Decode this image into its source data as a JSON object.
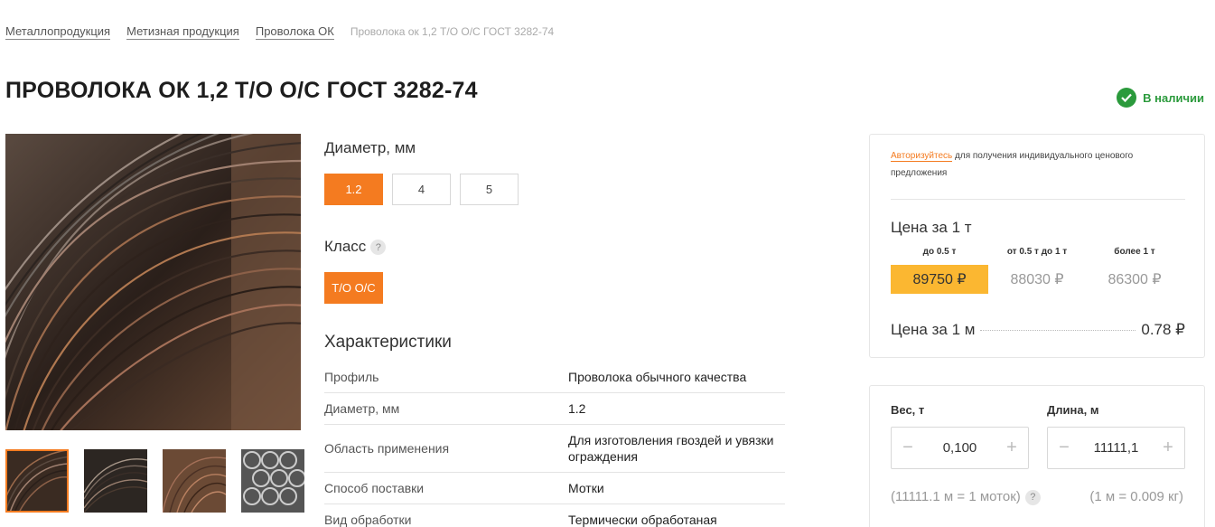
{
  "breadcrumb": {
    "items": [
      "Металлопродукция",
      "Метизная продукция",
      "Проволока ОК"
    ],
    "current": "Проволока ок 1,2 Т/О О/С ГОСТ 3282-74"
  },
  "title": "ПРОВОЛОКА ОК 1,2 Т/О О/С ГОСТ 3282-74",
  "stock": {
    "label": "В наличии",
    "color": "#2b9a3c"
  },
  "diameter": {
    "label": "Диаметр, мм",
    "options": [
      "1.2",
      "4",
      "5"
    ],
    "selected": "1.2"
  },
  "class": {
    "label": "Класс",
    "help": "?",
    "options": [
      "Т/О О/С"
    ],
    "selected": "Т/О О/С"
  },
  "characteristics": {
    "title": "Характеристики",
    "rows": [
      {
        "key": "Профиль",
        "value": "Проволока обычного качества"
      },
      {
        "key": "Диаметр, мм",
        "value": "1.2"
      },
      {
        "key": "Область применения",
        "value": "Для изготовления гвоздей и увязки ограждения"
      },
      {
        "key": "Способ поставки",
        "value": "Мотки"
      },
      {
        "key": "Вид обработки",
        "value": "Термически обработаная"
      }
    ]
  },
  "price_card": {
    "auth_link": "Авторизуйтесь",
    "auth_text": " для получения индивидуального ценового предложения",
    "price_head": "Цена за 1 т",
    "tiers": [
      {
        "label": "до 0.5 т",
        "price": "89750 ₽",
        "active": true
      },
      {
        "label": "от 0.5 т до 1 т",
        "price": "88030 ₽",
        "active": false
      },
      {
        "label": "более 1 т",
        "price": "86300 ₽",
        "active": false
      }
    ],
    "per_m_label": "Цена за 1 м",
    "per_m_value": "0.78 ₽"
  },
  "calculator": {
    "weight_label": "Вес, т",
    "weight_value": "0,100",
    "length_label": "Длина, м",
    "length_value": "11111,1",
    "minus": "−",
    "plus": "+",
    "coil_note": "(11111.1 м = 1 моток)",
    "help": "?",
    "meter_note": "(1 м = 0.009 кг)"
  },
  "colors": {
    "accent": "#f47b20",
    "price_highlight": "#fbb731",
    "stock_green": "#2b9a3c"
  }
}
